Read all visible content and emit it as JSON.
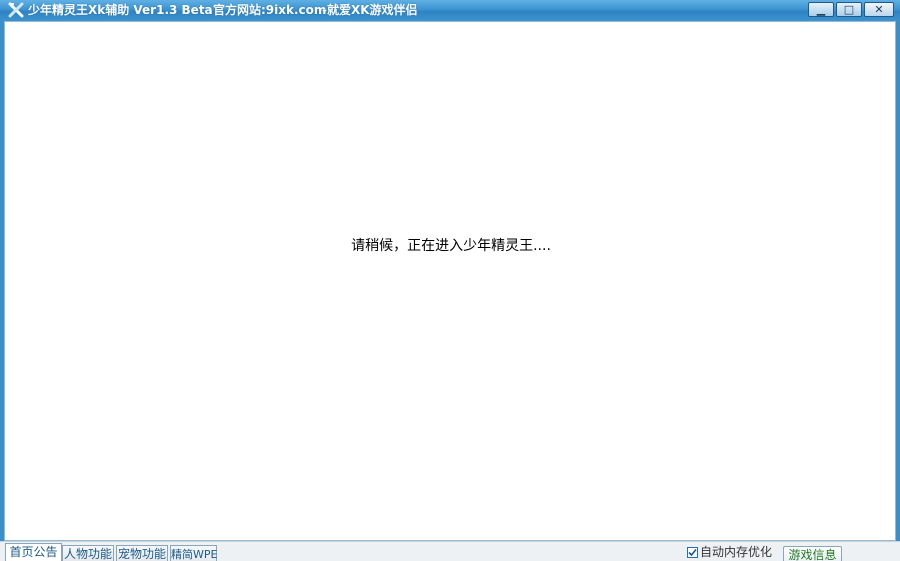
{
  "window": {
    "title": "少年精灵王Xk辅助 Ver1.3 Beta",
    "website": "官方网站:9ixk.com",
    "slogan": "-就爱XK游戏伴侣",
    "controls": {
      "minimize": "▁",
      "maximize": "□",
      "close": "✕"
    }
  },
  "main": {
    "loading_message": "请稍候，正在进入少年精灵王...."
  },
  "bottom_tabs": [
    {
      "label": "首页公告",
      "active": true
    },
    {
      "label": "人物功能",
      "active": false
    },
    {
      "label": "宠物功能",
      "active": false
    },
    {
      "label": "精简WPE",
      "active": false
    }
  ],
  "memory_optimize": {
    "label": "自动内存优化",
    "checked": true
  },
  "game_info_button": {
    "label": "游戏信息"
  },
  "colors": {
    "titlebar": "#3c93cf",
    "tab_text": "#1c5a8a",
    "game_info_text": "#1f7a1f"
  },
  "icons": {
    "app": "xk-logo-icon",
    "checkbox": "checkmark-icon"
  }
}
